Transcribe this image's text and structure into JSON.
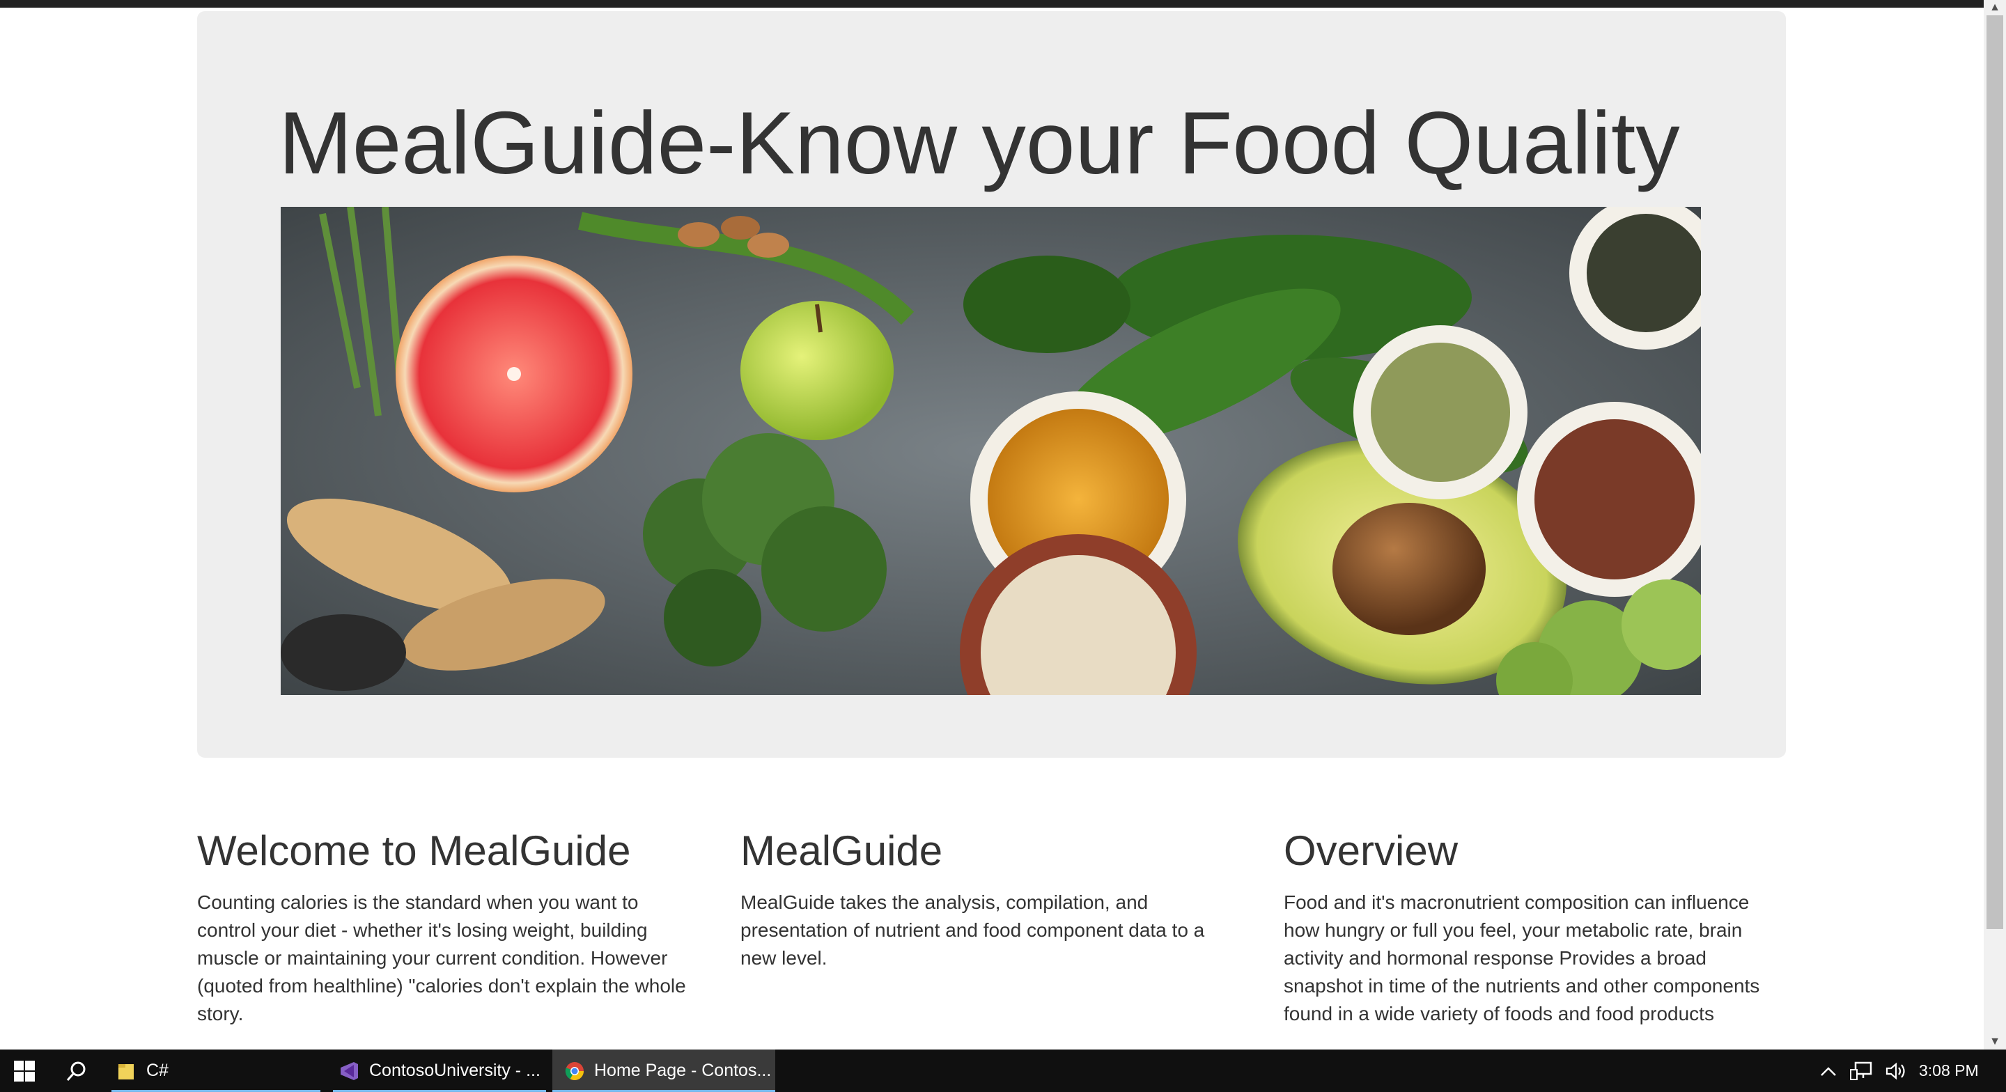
{
  "page": {
    "hero_title": "MealGuide-Know your Food Quality",
    "hero_image_alt": "Assorted healthy foods"
  },
  "columns": [
    {
      "title": "Welcome to MealGuide",
      "text": "Counting calories is the standard when you want to control your diet - whether it's losing weight, building muscle or maintaining your current condition. However (quoted from healthline) \"calories don't explain the whole story."
    },
    {
      "title": "MealGuide",
      "text": "MealGuide takes the analysis, compilation, and presentation of nutrient and food component data to a new level."
    },
    {
      "title": "Overview",
      "text": "Food and it's macronutrient composition can influence how hungry or full you feel, your metabolic rate, brain activity and hormonal response Provides a broad snapshot in time of the nutrients and other components found in a wide variety of foods and food products"
    }
  ],
  "taskbar": {
    "items": [
      {
        "label": "C#",
        "icon": "folder-icon"
      },
      {
        "label": "ContosoUniversity - ...",
        "icon": "visual-studio-icon"
      },
      {
        "label": "Home Page - Contos...",
        "icon": "chrome-icon"
      }
    ],
    "clock": "3:08 PM"
  },
  "colors": {
    "jumbotron_bg": "#eeeeee",
    "text": "#333333",
    "taskbar_bg": "#101010",
    "taskbar_active": "#3a3a3a",
    "accent_underline": "#76b9ed"
  }
}
